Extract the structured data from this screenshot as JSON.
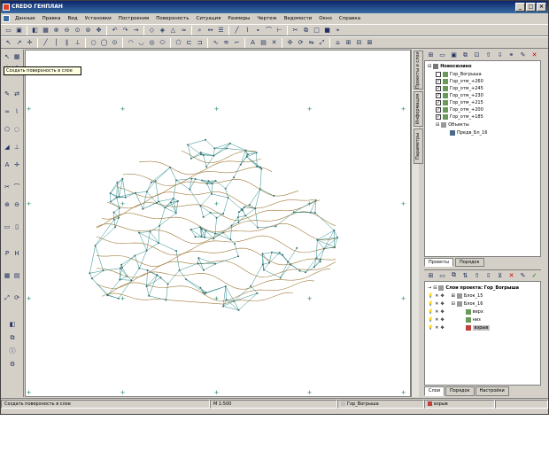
{
  "window": {
    "title": "CREDO ГЕНПЛАН",
    "min": "_",
    "max": "□",
    "close": "×"
  },
  "menu": [
    "Данные",
    "Правка",
    "Вид",
    "Установки",
    "Построения",
    "Поверхность",
    "Ситуация",
    "Размеры",
    "Чертеж",
    "Ведомости",
    "Окно",
    "Справка"
  ],
  "tooltip": "Создать поверхность в слое",
  "side_tabs": [
    "Проекты и слои",
    "Информация",
    "Параметры"
  ],
  "project_tree": {
    "root": "Новосюзино",
    "items": [
      "Гор_Вогрыша",
      "Гор_отм_+260",
      "Гор_отм_+245",
      "Гор_отм_+230",
      "Гор_отм_+215",
      "Гор_отм_+200",
      "Гор_отм_+185"
    ],
    "objects_label": "Объекты",
    "objects_child": "Предв_Бл_16"
  },
  "panel_tabs_top": [
    "Проекты",
    "Порядок"
  ],
  "layer_tree": {
    "root": "Слои проекта: Гор_Вогрыша",
    "items": [
      "Блок_15",
      "Блок_16",
      "верх",
      "низ",
      "взрыв"
    ]
  },
  "panel_tabs_bottom": [
    "Слои",
    "Порядок",
    "Настройки"
  ],
  "status": {
    "hint": "Создать поверхность в слое",
    "scale": "М 1:500",
    "layer": "Гор_Вогрыша",
    "active": "взрыв"
  },
  "colors": {
    "surface_edge": "#2b8a8a",
    "contour": "#a07a3a",
    "grid_mark": "#2a8a6a"
  }
}
